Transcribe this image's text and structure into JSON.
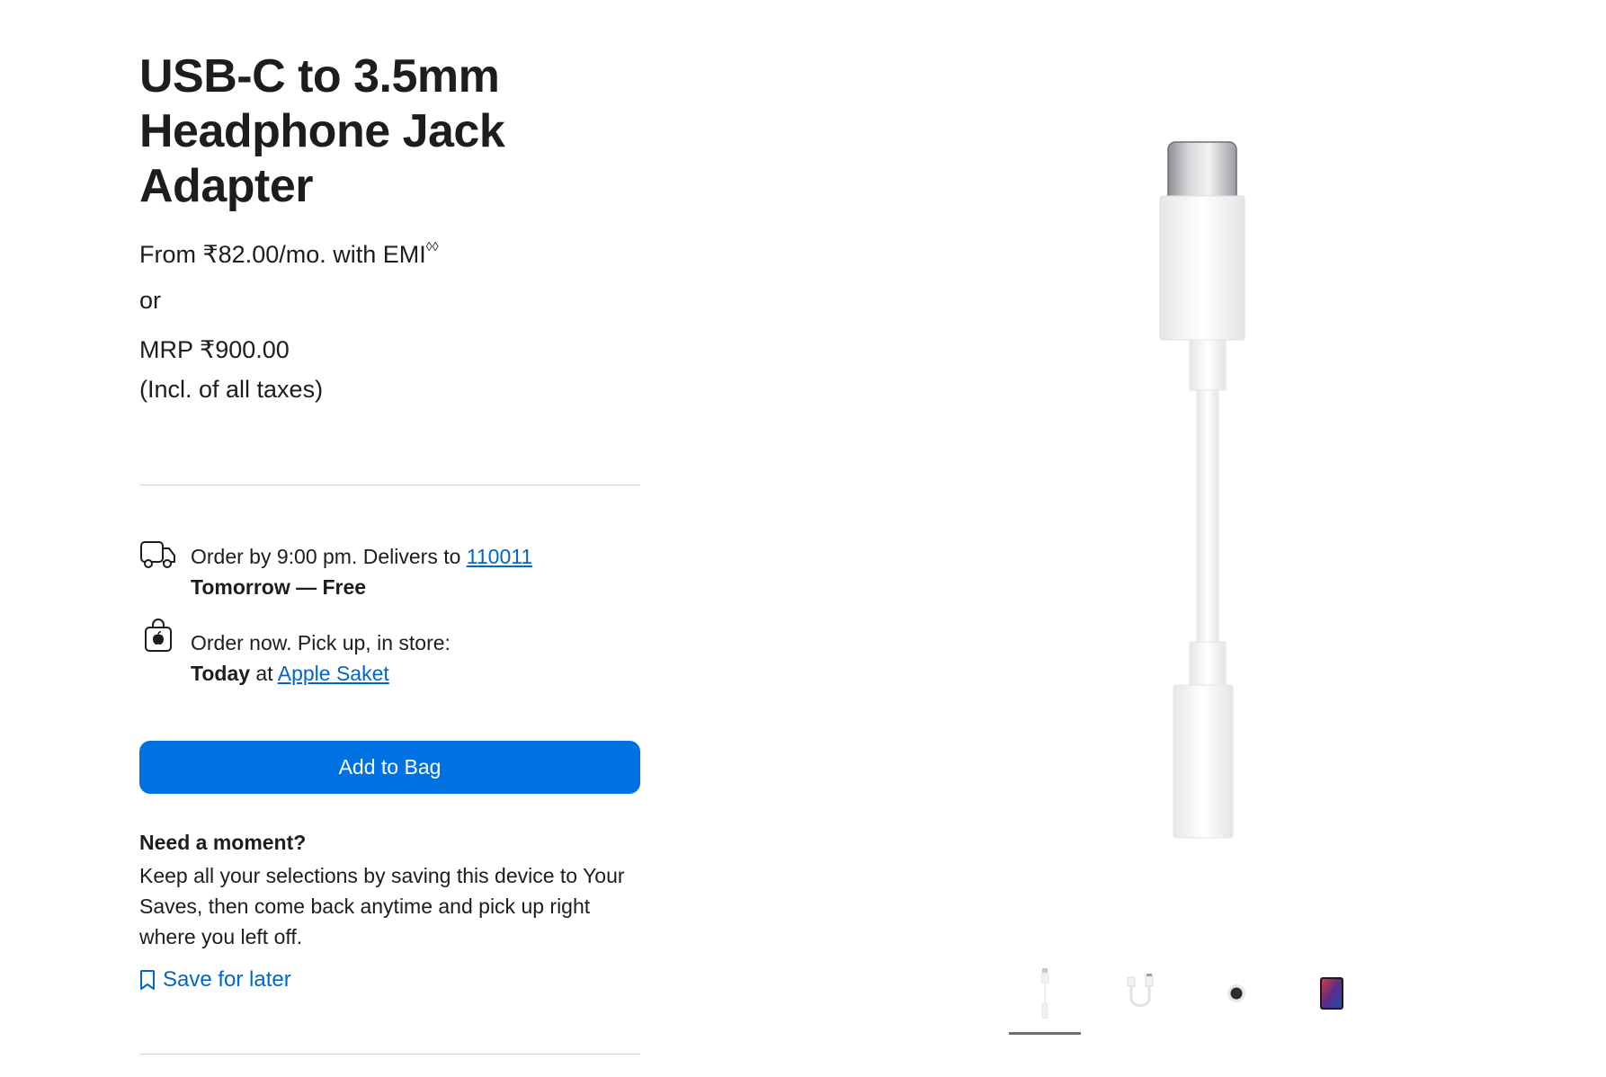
{
  "product": {
    "title_lines": [
      "USB-C to 3.5mm",
      "Headphone Jack",
      "Adapter"
    ]
  },
  "pricing": {
    "emi_text": "From ₹82.00/mo. with EMI",
    "emi_superscript": "◊◊",
    "or_text": "or",
    "mrp_text": "MRP ₹900.00",
    "taxes_text": "(Incl. of all taxes)"
  },
  "delivery": {
    "icon": "delivery-truck-icon",
    "prefix": "Order by 9:00 pm. Delivers to ",
    "zip_link": "110011",
    "eta": "Tomorrow — Free"
  },
  "pickup": {
    "icon": "apple-store-bag-icon",
    "line1": "Order now. Pick up, in store:",
    "day": "Today",
    "at_text": " at ",
    "store_link": "Apple Saket"
  },
  "actions": {
    "add_to_bag": "Add to Bag"
  },
  "save": {
    "heading": "Need a moment?",
    "body": "Keep all your selections by saving this device to Your Saves, then come back anytime and pick up right where you left off.",
    "link_label": "Save for later",
    "icon": "bookmark-icon"
  },
  "gallery": {
    "thumbnails": [
      {
        "icon": "adapter-front-thumbnail",
        "selected": true
      },
      {
        "icon": "adapter-coiled-thumbnail",
        "selected": false
      },
      {
        "icon": "jack-port-thumbnail",
        "selected": false
      },
      {
        "icon": "ipad-thumbnail",
        "selected": false
      }
    ]
  },
  "colors": {
    "accent": "#0071e3",
    "link": "#0066cc",
    "text": "#1d1d1f",
    "divider": "#d2d2d7"
  }
}
